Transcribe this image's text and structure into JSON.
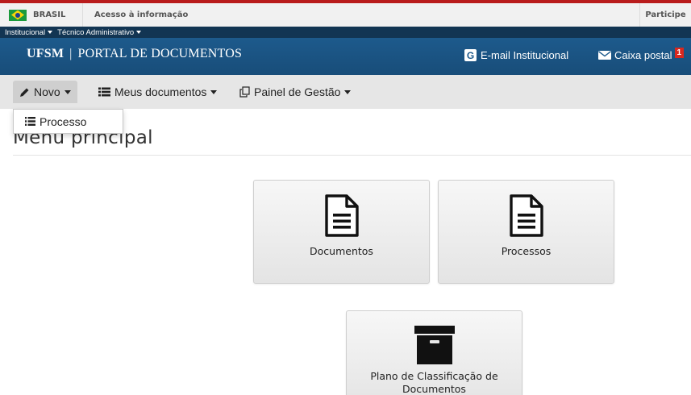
{
  "gov_bar": {
    "brasil": "BRASIL",
    "acesso": "Acesso à informação",
    "participe": "Participe"
  },
  "sub_bar": {
    "institucional": "Institucional",
    "tecnico": "Técnico Administrativo"
  },
  "header": {
    "brand_short": "UFSM",
    "brand_separator": "|",
    "brand_name": "PORTAL DE DOCUMENTOS",
    "email_label": "E-mail Institucional",
    "email_icon_letter": "G",
    "mail_label": "Caixa postal",
    "mail_badge": "1"
  },
  "navbar": {
    "novo": "Novo",
    "meus_documentos": "Meus documentos",
    "painel_gestao": "Painel de Gestão"
  },
  "dropdown": {
    "processo": "Processo"
  },
  "main": {
    "title": "Menu principal",
    "tiles": [
      {
        "label": "Documentos",
        "icon": "document-icon"
      },
      {
        "label": "Processos",
        "icon": "document-icon"
      },
      {
        "label": "Plano de Classificação de Documentos",
        "icon": "archive-box-icon"
      }
    ]
  },
  "colors": {
    "top_accent": "#b91c1c",
    "sub_bar": "#123553",
    "header": "#1d5a8c",
    "badge": "#d9281f"
  }
}
